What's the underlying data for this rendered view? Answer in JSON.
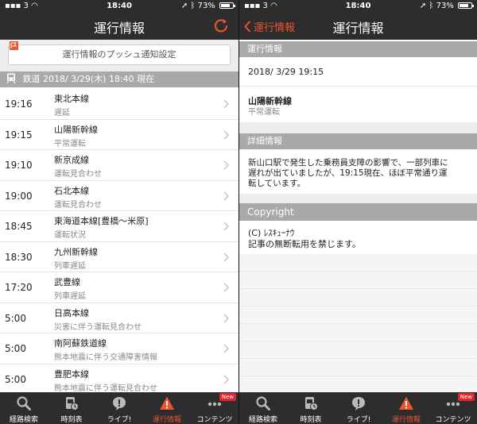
{
  "left": {
    "status": {
      "carrier": "3",
      "time": "18:40",
      "battery": "73%"
    },
    "title": "運行情報",
    "push_label": "運行情報のプッシュ通知設定",
    "section_label": "鉄道 2018/ 3/29(木) 18:40 現在",
    "rows": [
      {
        "time": "19:16",
        "line": "東北本線",
        "state": "遅延"
      },
      {
        "time": "19:15",
        "line": "山陽新幹線",
        "state": "平常運転"
      },
      {
        "time": "19:10",
        "line": "新京成線",
        "state": "運転見合わせ"
      },
      {
        "time": "19:00",
        "line": "石北本線",
        "state": "運転見合わせ"
      },
      {
        "time": "18:45",
        "line": "東海道本線[豊橋〜米原]",
        "state": "運転状況"
      },
      {
        "time": "18:30",
        "line": "九州新幹線",
        "state": "列車遅延"
      },
      {
        "time": "17:20",
        "line": "武豊線",
        "state": "列車遅延"
      },
      {
        "time": "5:00",
        "line": "日高本線",
        "state": "災害に伴う運転見合わせ"
      },
      {
        "time": "5:00",
        "line": "南阿蘇鉄道線",
        "state": "熊本地震に伴う交通障害情報"
      },
      {
        "time": "5:00",
        "line": "豊肥本線",
        "state": "熊本地震に伴う運転見合わせ"
      }
    ]
  },
  "right": {
    "status": {
      "carrier": "3",
      "time": "18:40",
      "battery": "73%"
    },
    "back_label": "運行情報",
    "title": "運行情報",
    "sec1": "運行情報",
    "datetime": "2018/ 3/29 19:15",
    "line": "山陽新幹線",
    "state": "平常運転",
    "sec2": "詳細情報",
    "detail_l1": "新山口駅で発生した乗務員支障の影響で、一部列車に",
    "detail_l2": "遅れが出ていましたが、19:15現在、ほぼ平常通り運",
    "detail_l3": "転しています。",
    "sec3": "Copyright",
    "copy_l1": "(C) ﾚｽｷｭｰﾅｳ",
    "copy_l2": "記事の無断転用を禁じます。"
  },
  "tabs": [
    {
      "label": "経路検索",
      "icon": "search-icon"
    },
    {
      "label": "時刻表",
      "icon": "timetable-icon"
    },
    {
      "label": "ライブ!",
      "icon": "live-icon"
    },
    {
      "label": "運行情報",
      "icon": "warning-icon"
    },
    {
      "label": "コンテンツ",
      "icon": "more-icon",
      "badge": "New"
    }
  ],
  "colors": {
    "accent": "#e8552f",
    "bar": "#2d2d2d",
    "section": "#a9a9a9"
  }
}
